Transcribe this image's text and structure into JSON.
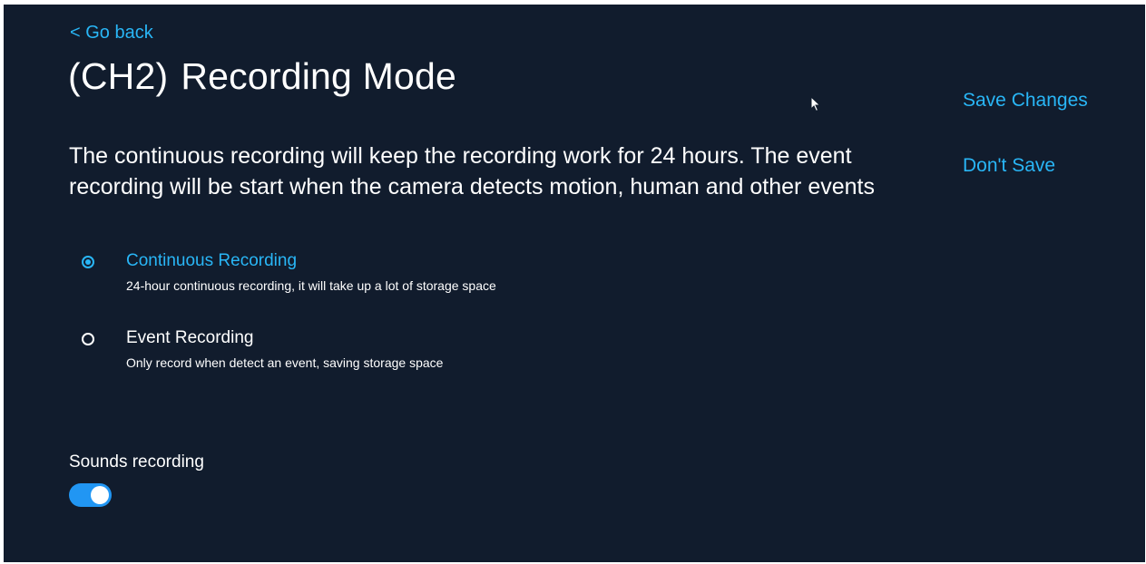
{
  "nav": {
    "back_label": "< Go back"
  },
  "header": {
    "channel": "(CH2)",
    "title": "Recording Mode"
  },
  "actions": {
    "save_label": "Save Changes",
    "dont_save_label": "Don't Save"
  },
  "description": "The continuous recording will keep the recording work for 24 hours. The event recording will be start when the camera detects motion, human and other events",
  "options": [
    {
      "label": "Continuous Recording",
      "description": "24-hour continuous recording, it will take up a lot of storage space",
      "selected": true
    },
    {
      "label": "Event Recording",
      "description": "Only record when detect an event, saving storage space",
      "selected": false
    }
  ],
  "sounds": {
    "label": "Sounds recording",
    "enabled": true
  },
  "colors": {
    "background": "#111c2d",
    "accent": "#29b6f6",
    "toggle_on": "#2196f3",
    "text": "#ffffff"
  }
}
